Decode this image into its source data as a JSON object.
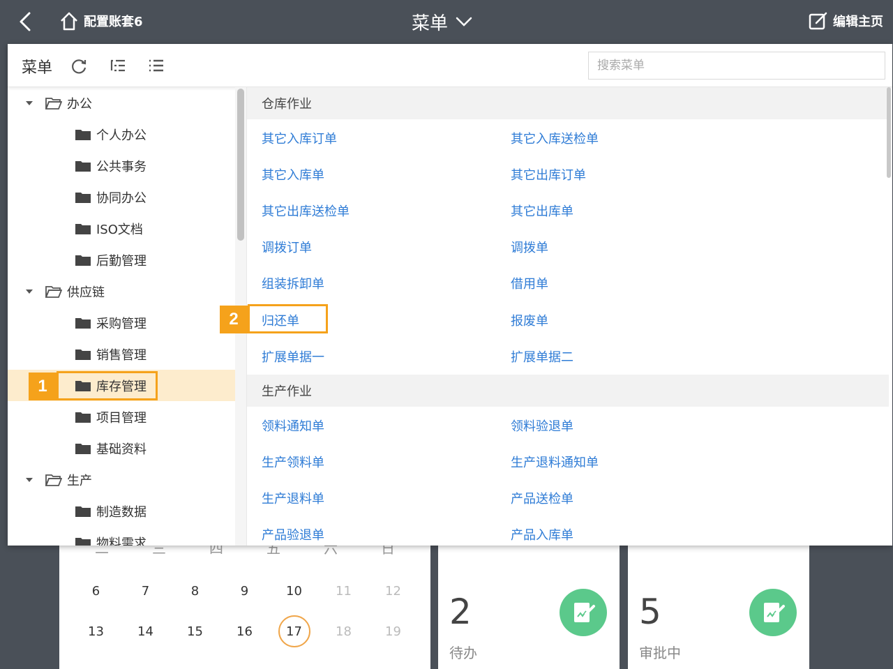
{
  "topbar": {
    "home_label": "配置账套6",
    "title": "菜单",
    "edit_label": "编辑主页"
  },
  "menu": {
    "toolbar_title": "菜单",
    "search_placeholder": "搜索菜单",
    "tree": [
      {
        "label": "办公",
        "level": 0,
        "expanded": true
      },
      {
        "label": "个人办公",
        "level": 1
      },
      {
        "label": "公共事务",
        "level": 1
      },
      {
        "label": "协同办公",
        "level": 1
      },
      {
        "label": "ISO文档",
        "level": 1
      },
      {
        "label": "后勤管理",
        "level": 1
      },
      {
        "label": "供应链",
        "level": 0,
        "expanded": true
      },
      {
        "label": "采购管理",
        "level": 1
      },
      {
        "label": "销售管理",
        "level": 1
      },
      {
        "label": "库存管理",
        "level": 1,
        "selected": true
      },
      {
        "label": "项目管理",
        "level": 1
      },
      {
        "label": "基础资料",
        "level": 1
      },
      {
        "label": "生产",
        "level": 0,
        "expanded": true
      },
      {
        "label": "制造数据",
        "level": 1
      },
      {
        "label": "物料需求",
        "level": 1
      }
    ],
    "sections": [
      {
        "title": "仓库作业",
        "links": [
          "其它入库订单",
          "其它入库送检单",
          "其它入库单",
          "其它出库订单",
          "其它出库送检单",
          "其它出库单",
          "调拨订单",
          "调拨单",
          "组装拆卸单",
          "借用单",
          "归还单",
          "报废单",
          "扩展单据一",
          "扩展单据二"
        ]
      },
      {
        "title": "生产作业",
        "links": [
          "领料通知单",
          "领料验退单",
          "生产领料单",
          "生产退料通知单",
          "生产退料单",
          "产品送检单",
          "产品验退单",
          "产品入库单"
        ]
      }
    ]
  },
  "calendar": {
    "weekdays": [
      "二",
      "三",
      "四",
      "五",
      "六",
      "日"
    ],
    "row1": [
      "6",
      "7",
      "8",
      "9",
      "10",
      "11",
      "12"
    ],
    "row2": [
      "13",
      "14",
      "15",
      "16",
      "17",
      "18",
      "19"
    ],
    "today": "17"
  },
  "stats": [
    {
      "value": "2",
      "label": "待办"
    },
    {
      "value": "5",
      "label": "审批中"
    }
  ],
  "annotations": {
    "callout1": "1",
    "callout2": "2"
  },
  "colors": {
    "background": "#4a5058",
    "link": "#2f7cd6",
    "highlight": "#f5a21b",
    "selected_row": "#fdeccd",
    "stat_icon": "#5bc98b"
  }
}
